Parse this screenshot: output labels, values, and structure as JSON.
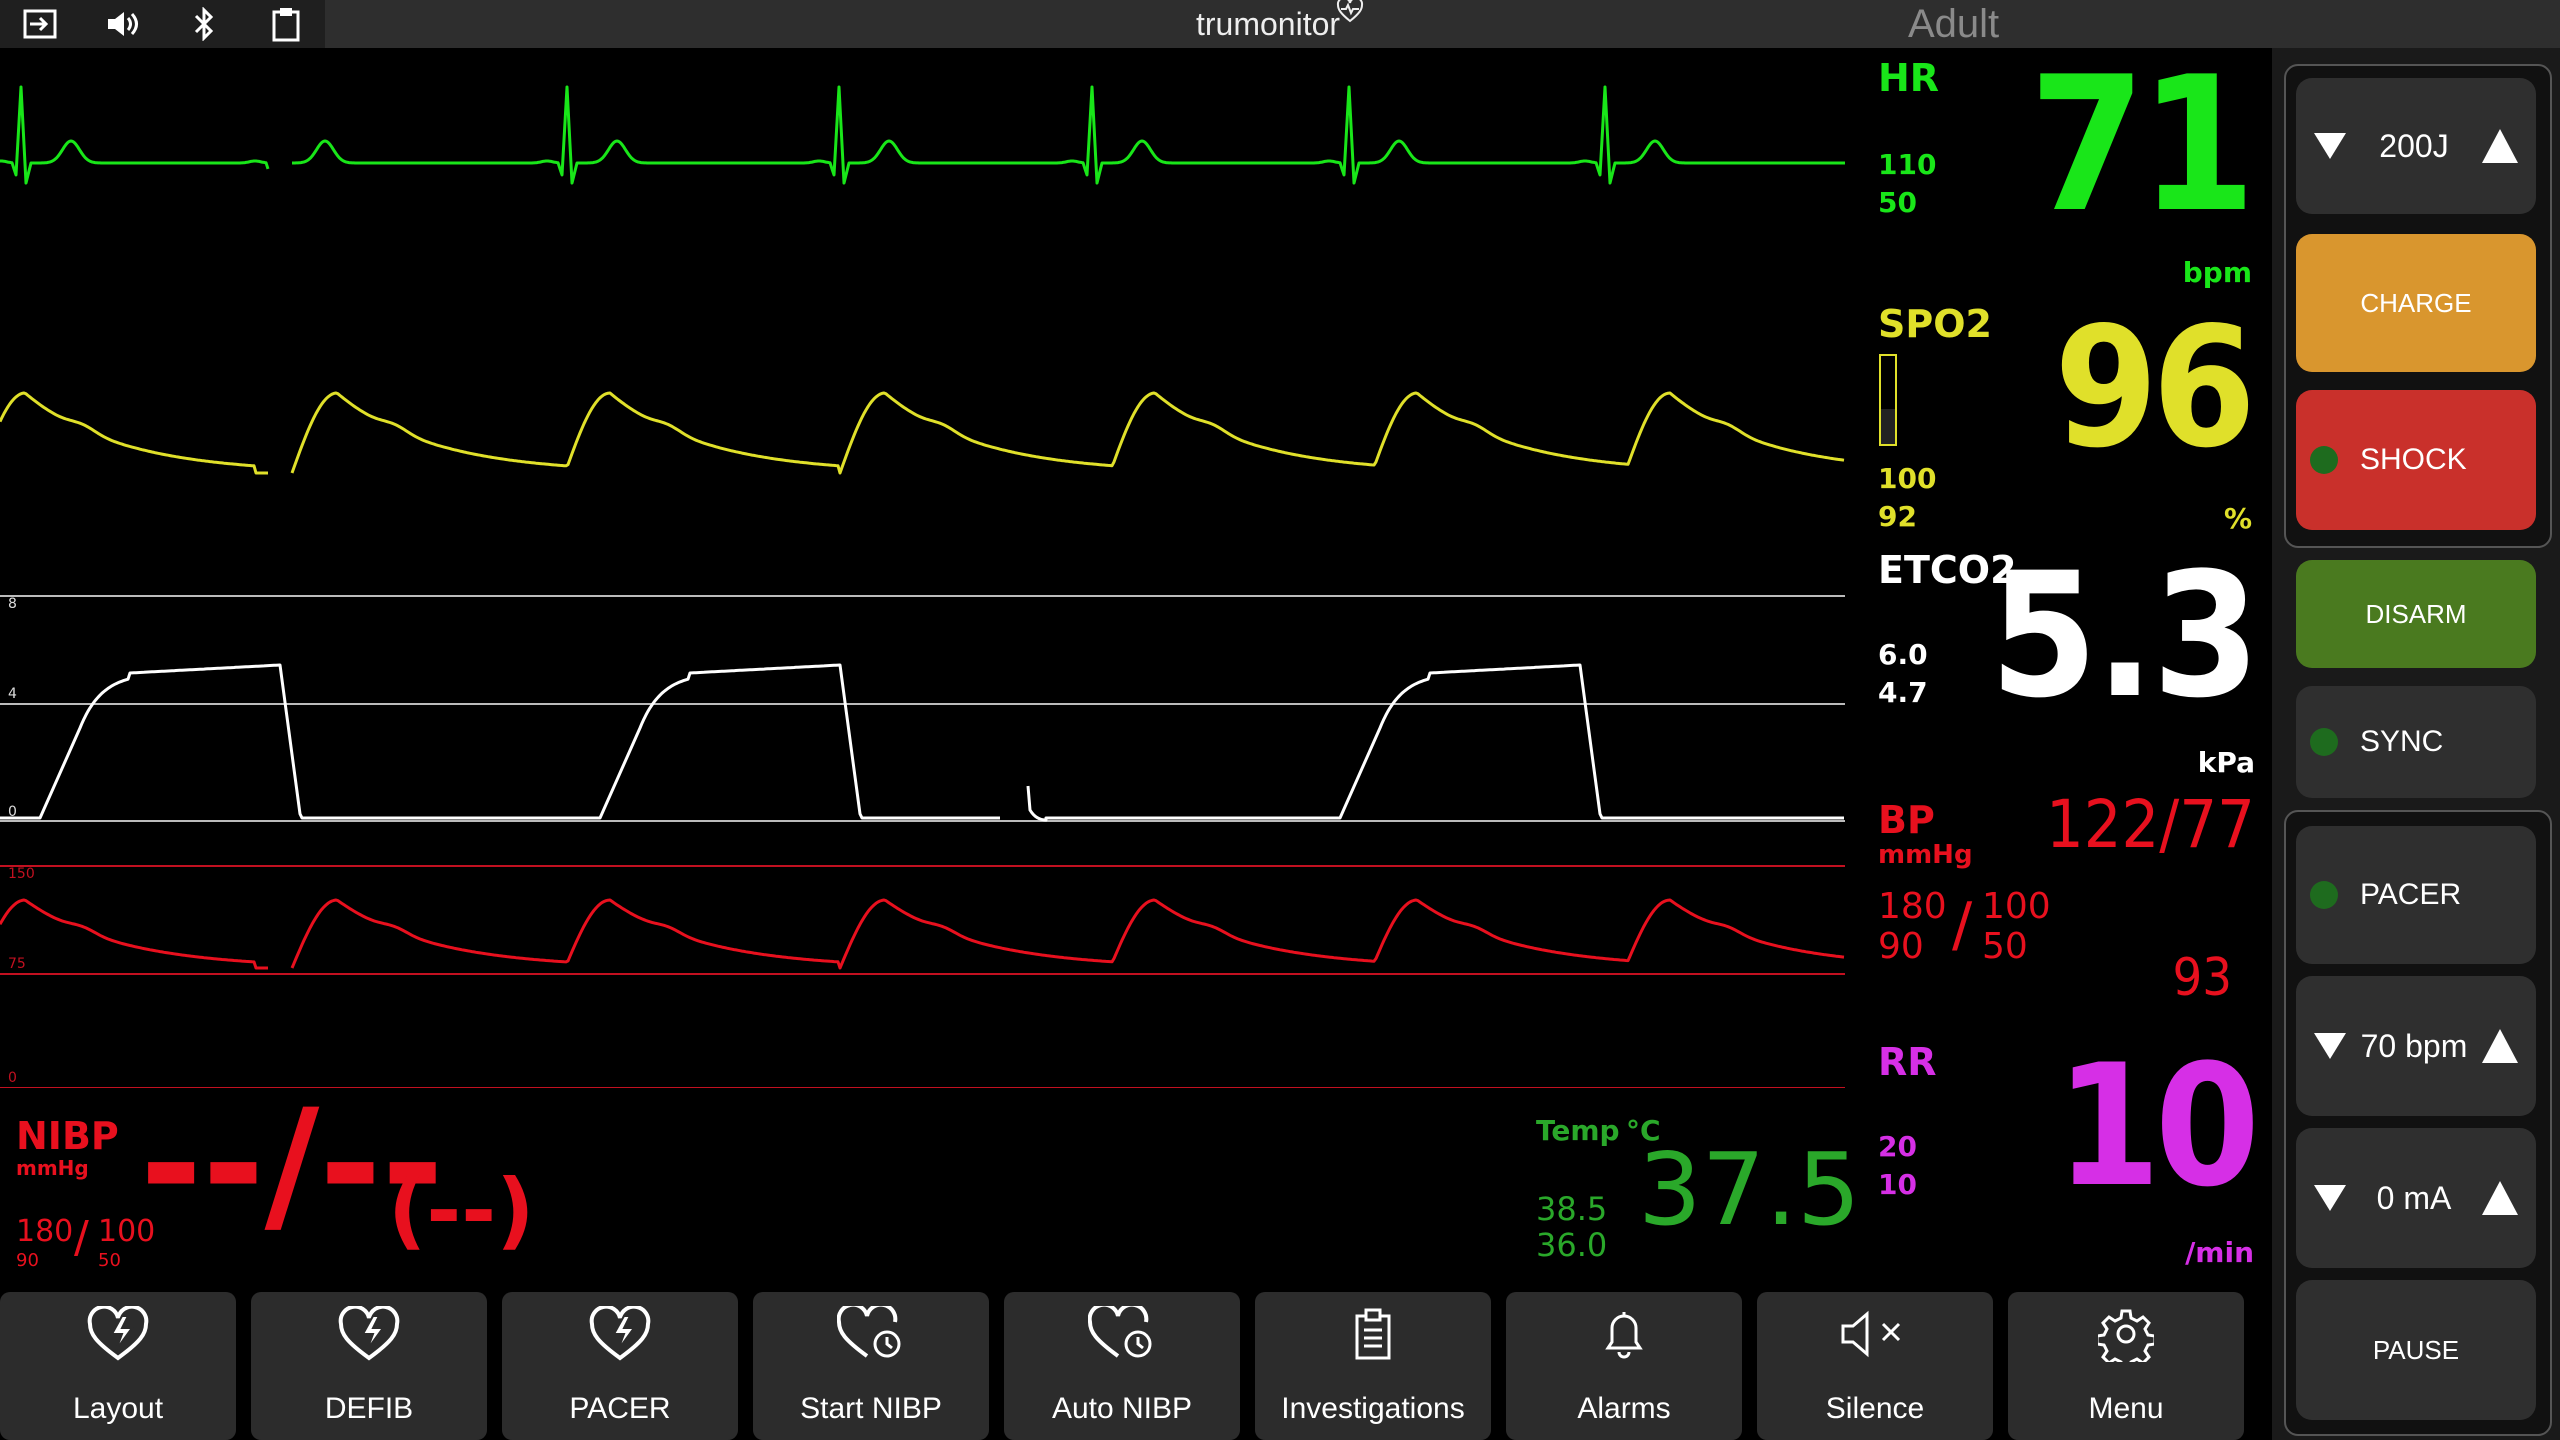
{
  "topbar": {
    "brand": "trumonitor",
    "mode": "Adult",
    "icons": [
      "exit-icon",
      "speaker-icon",
      "bluetooth-icon",
      "clipboard-icon"
    ]
  },
  "colors": {
    "hr": "#19e619",
    "spo2": "#e0e02a",
    "etco2": "#ffffff",
    "bp": "#e8101e",
    "rr": "#d62fe6",
    "temp": "#2aa82a",
    "charge": "#d9962e",
    "shock": "#c9302b",
    "disarm": "#4a7a1f"
  },
  "vitals": {
    "hr": {
      "label": "HR",
      "hi": "110",
      "lo": "50",
      "value": "71",
      "unit": "bpm"
    },
    "spo2": {
      "label": "SPO2",
      "hi": "100",
      "lo": "92",
      "value": "96",
      "unit": "%",
      "signal_level": 0.6
    },
    "etco2": {
      "label": "ETCO2",
      "hi": "6.0",
      "lo": "4.7",
      "value": "5.3",
      "unit": "kPa"
    },
    "bp": {
      "label": "BP",
      "unit": "mmHg",
      "value": "122/77",
      "sys_hi": "180",
      "sys_lo": "90",
      "slash": "/",
      "dia_hi": "100",
      "dia_lo": "50",
      "mean": "93"
    },
    "rr": {
      "label": "RR",
      "hi": "20",
      "lo": "10",
      "value": "10",
      "unit": "/min"
    },
    "nibp": {
      "label": "NIBP",
      "unit": "mmHg",
      "value": "--/--",
      "mean": "(--)",
      "sys_hi": "180",
      "sys_lo": "90",
      "slash": "/",
      "dia_hi": "100",
      "dia_lo": "50"
    },
    "temp": {
      "label": "Temp",
      "unit": "°C",
      "hi": "38.5",
      "lo": "36.0",
      "value": "37.5"
    }
  },
  "waveform_scales": {
    "etco2": [
      "8",
      "4",
      "0"
    ],
    "bp": [
      "150",
      "75",
      "0"
    ]
  },
  "right_panel": {
    "energy": "200J",
    "charge": "CHARGE",
    "shock": "SHOCK",
    "disarm": "DISARM",
    "sync": "SYNC",
    "pacer": "PACER",
    "rate": "70 bpm",
    "current": "0 mA",
    "pause": "PAUSE"
  },
  "bottom_bar": [
    {
      "label": "Layout",
      "icon": "heart-bolt-icon"
    },
    {
      "label": "DEFIB",
      "icon": "heart-bolt-icon"
    },
    {
      "label": "PACER",
      "icon": "heart-bolt-icon"
    },
    {
      "label": "Start NIBP",
      "icon": "heart-clock-icon"
    },
    {
      "label": "Auto NIBP",
      "icon": "heart-clock-icon"
    },
    {
      "label": "Investigations",
      "icon": "clipboard-list-icon"
    },
    {
      "label": "Alarms",
      "icon": "bell-icon"
    },
    {
      "label": "Silence",
      "icon": "speaker-mute-icon"
    },
    {
      "label": "Menu",
      "icon": "gear-icon"
    }
  ]
}
